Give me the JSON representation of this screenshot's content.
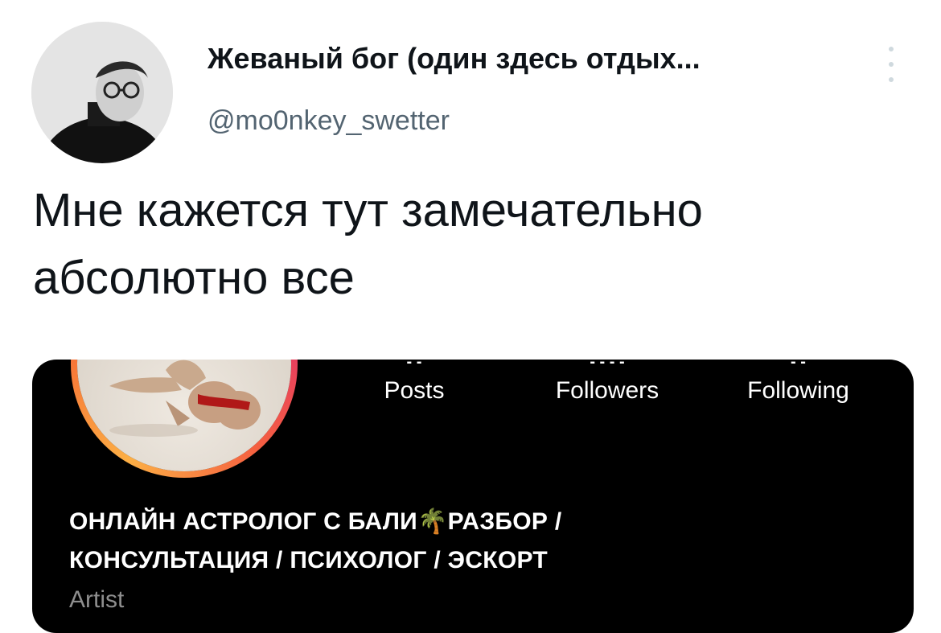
{
  "tweet": {
    "author": {
      "display_name": "Жеваный бог (один здесь отдых...",
      "handle": "@mo0nkey_swetter"
    },
    "more_icon": "more-vertical-icon",
    "text_line1": "Мне кажется тут замечательно",
    "text_line2": "абсолютно все"
  },
  "embedded_profile": {
    "stats": [
      {
        "label": "Posts"
      },
      {
        "label": "Followers"
      },
      {
        "label": "Following"
      }
    ],
    "bio_line1": "ОНЛАЙН АСТРОЛОГ С БАЛИ🌴РАЗБОР /",
    "bio_line2": "КОНСУЛЬТАЦИЯ / ПСИХОЛОГ / ЭСКОРТ",
    "category": "Artist",
    "colors": {
      "background": "#000000",
      "ring_gradient": [
        "#c13584",
        "#e1306c",
        "#f56040",
        "#fcaf45"
      ]
    }
  }
}
